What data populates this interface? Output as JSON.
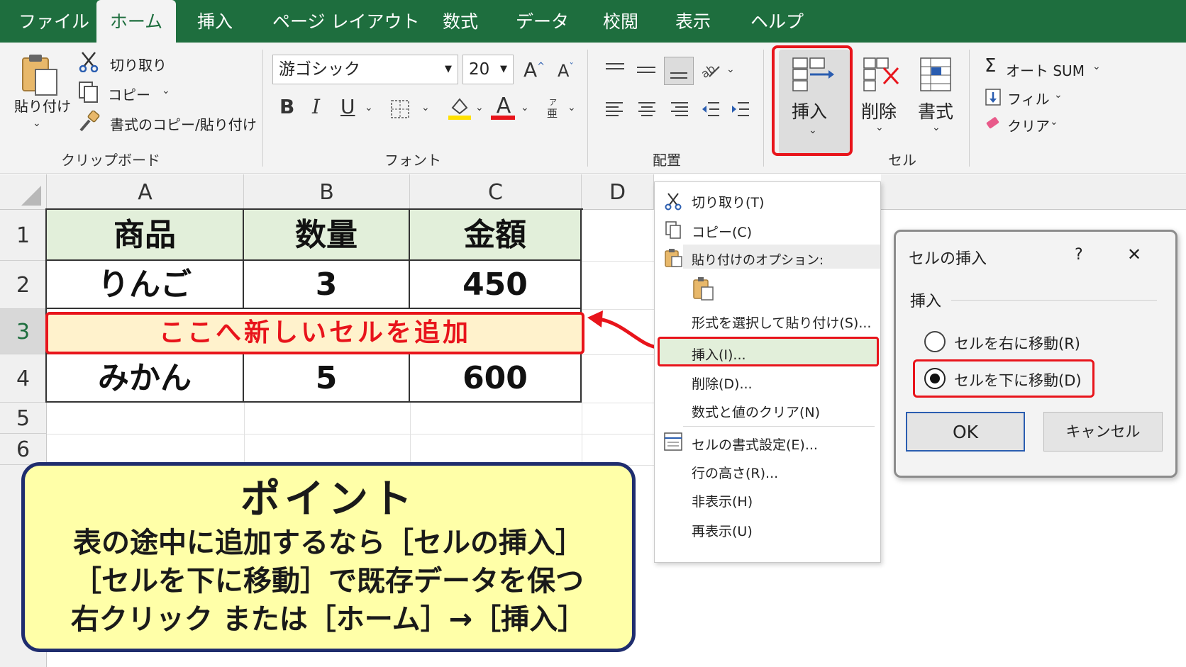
{
  "tabs": [
    "ファイル",
    "ホーム",
    "挿入",
    "ページ レイアウト",
    "数式",
    "データ",
    "校閲",
    "表示",
    "ヘルプ"
  ],
  "active_tab": "ホーム",
  "clipboard": {
    "paste_label": "貼り付け",
    "cut_label": "切り取り",
    "copy_label": "コピー",
    "format_painter_label": "書式のコピー/貼り付け",
    "group_label": "クリップボード"
  },
  "font": {
    "font_name": "游ゴシック",
    "font_size": "20",
    "grow_label": "A",
    "shrink_label": "A",
    "bold": "B",
    "italic": "I",
    "underline": "U",
    "font_color_label": "A",
    "group_label": "フォント"
  },
  "alignment": {
    "group_label": "配置"
  },
  "cells_group": {
    "insert_label": "挿入",
    "delete_label": "削除",
    "format_label": "書式",
    "group_label": "セル"
  },
  "editing": {
    "autosum_label": "オート SUM",
    "fill_label": "フィル",
    "clear_label": "クリア"
  },
  "sheet": {
    "columns": [
      "A",
      "B",
      "C",
      "D"
    ],
    "rows": [
      "1",
      "2",
      "3",
      "4",
      "5",
      "6"
    ],
    "table": {
      "header": [
        "商品",
        "数量",
        "金額"
      ],
      "row2": [
        "りんご",
        "3",
        "450"
      ],
      "row4": [
        "みかん",
        "5",
        "600"
      ]
    },
    "insert_banner": "ここへ新しいセルを追加"
  },
  "context_menu": {
    "items": {
      "cut": "切り取り(T)",
      "copy": "コピー(C)",
      "paste_options": "貼り付けのオプション:",
      "paste_special": "形式を選択して貼り付け(S)...",
      "insert": "挿入(I)...",
      "delete": "削除(D)...",
      "clear": "数式と値のクリア(N)",
      "format_cells": "セルの書式設定(E)...",
      "row_height": "行の高さ(R)...",
      "hide": "非表示(H)",
      "unhide": "再表示(U)"
    }
  },
  "dialog": {
    "title": "セルの挿入",
    "help": "?",
    "close": "✕",
    "section": "挿入",
    "option_right": "セルを右に移動(R)",
    "option_down": "セルを下に移動(D)",
    "selected_option": "option_down",
    "ok": "OK",
    "cancel": "キャンセル"
  },
  "callout": {
    "title": "ポイント",
    "line1": "表の途中に追加するなら［セルの挿入］",
    "line2": "［セルを下に移動］で既存データを保つ",
    "line3": "右クリック または［ホーム］→［挿入］"
  },
  "colors": {
    "tab_green": "#1e6e3e",
    "header_fill": "#e2efda",
    "highlight_red": "#e8141b",
    "banner_fill": "#fff2cc",
    "callout_fill": "#ffffa8",
    "callout_border": "#1f2d6e"
  }
}
